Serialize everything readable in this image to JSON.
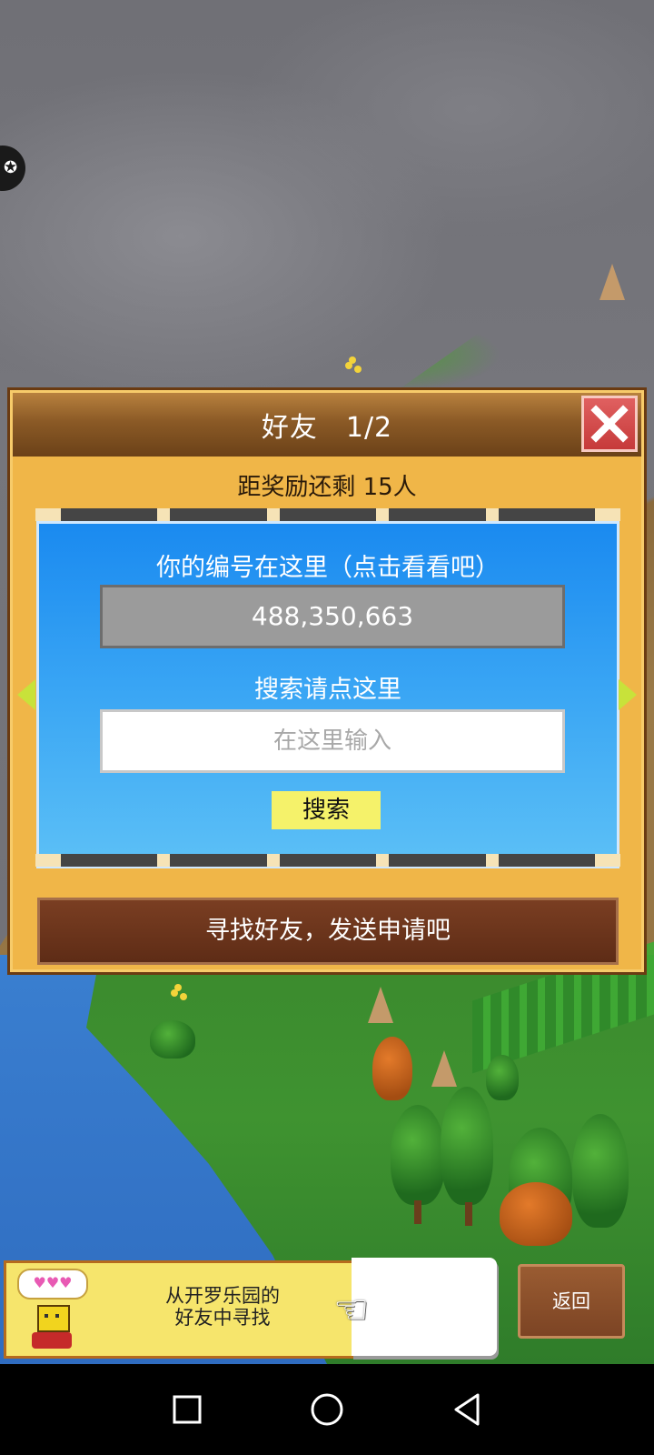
{
  "dialog": {
    "title": "好友　1/2",
    "reward_text": "距奖励还剩 15人",
    "your_id_label": "你的编号在这里（点击看看吧）",
    "your_id_value": "488,350,663",
    "search_label": "搜索请点这里",
    "search_placeholder": "在这里输入",
    "search_button": "搜索",
    "find_friends_button": "寻找好友，发送申请吧",
    "close_icon": "close-x-icon",
    "prev_icon": "arrow-left-icon",
    "next_icon": "arrow-right-icon"
  },
  "bottom": {
    "card_line1": "从开罗乐园的",
    "card_line2": "好友中寻找",
    "hearts": "♥♥♥",
    "back_button": "返回"
  },
  "nav": {
    "recents_icon": "square-icon",
    "home_icon": "circle-icon",
    "back_icon": "triangle-back-icon"
  },
  "colors": {
    "panel_blue": "#1a8af0",
    "dialog_gold": "#f0b648",
    "header_brown": "#8b5a26",
    "close_red": "#d04848",
    "search_yellow": "#f5f26a"
  }
}
